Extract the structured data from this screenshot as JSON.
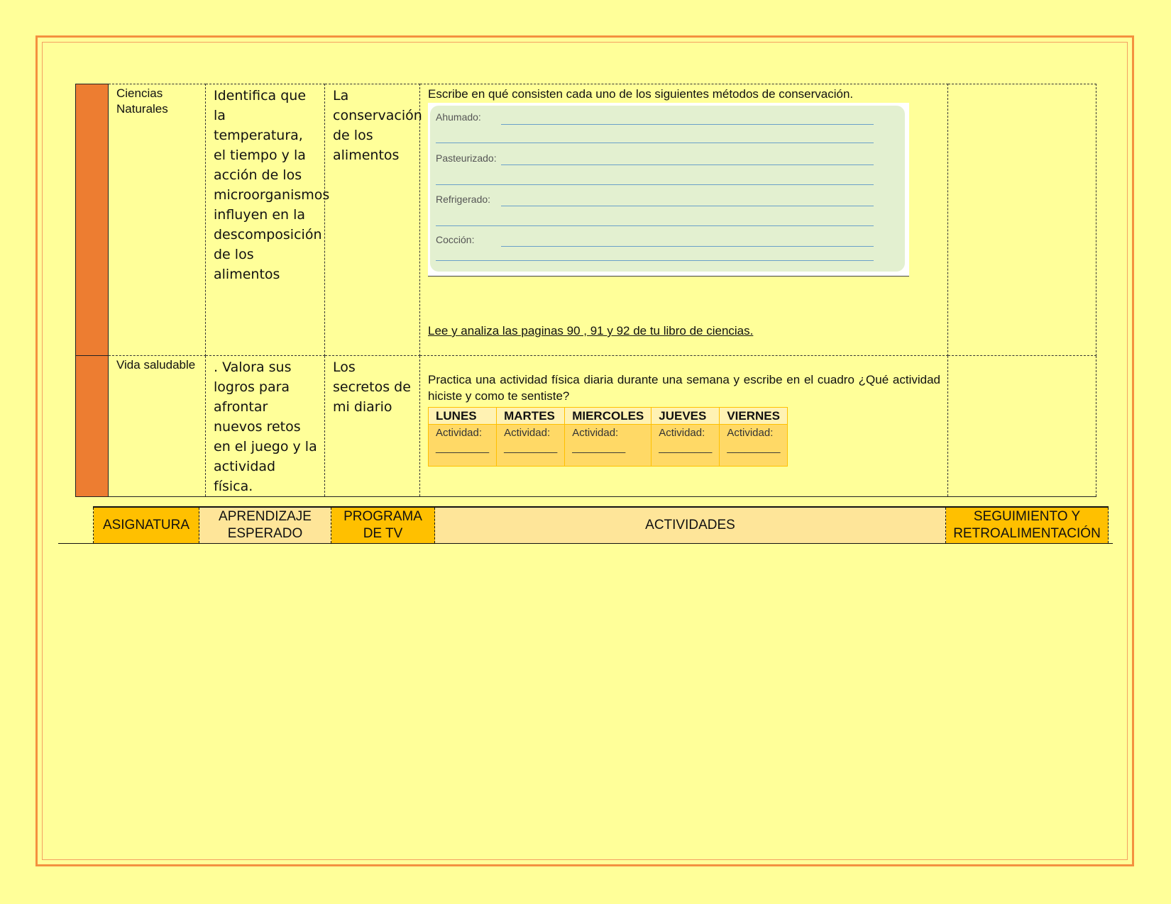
{
  "rows": [
    {
      "subject": "Ciencias Naturales",
      "aprendizaje": "Identifica que la temperatura, el tiempo y la acción de los microorganismos influyen en la descomposición de los alimentos",
      "programa": "La conservación de los alimentos",
      "actividad_intro": "Escribe en qué consisten cada uno de los siguientes métodos de conservación.",
      "metodos": [
        "Ahumado:",
        "Pasteurizado:",
        "Refrigerado:",
        "Cocción:"
      ],
      "actividad_link": "Lee y analiza las paginas 90 , 91 y 92 de tu libro de ciencias.",
      "seguimiento": ""
    },
    {
      "subject": "Vida saludable",
      "aprendizaje": ". Valora sus logros para afrontar nuevos retos en el juego y la actividad física.",
      "programa": "Los secretos de mi diario",
      "actividad_intro": "Practica una actividad física diaria durante una semana y escribe en el cuadro ¿Qué actividad hiciste y como te sentiste?",
      "dias": [
        "LUNES",
        "MARTES",
        "MIERCOLES",
        "JUEVES",
        "VIERNES"
      ],
      "dia_actividad": "Actividad:",
      "dia_linea": "_________",
      "seguimiento": ""
    }
  ],
  "header": {
    "asignatura": "ASIGNATURA",
    "aprendizaje": "APRENDIZAJE ESPERADO",
    "programa": "PROGRAMA DE TV",
    "actividades": "ACTIVIDADES",
    "seguimiento": "SEGUIMIENTO Y RETROALIMENTACIÓN"
  },
  "colors": {
    "page": "#ffff99",
    "accent_orange": "#ed7d31",
    "gold": "#ffc000",
    "pale_gold": "#fee599"
  }
}
